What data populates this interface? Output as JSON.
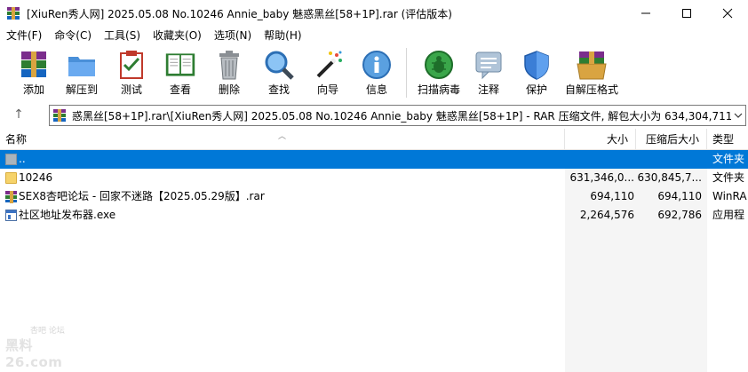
{
  "window": {
    "title": "[XiuRen秀人网] 2025.05.08 No.10246 Annie_baby 魅惑黑丝[58+1P].rar (评估版本)",
    "controls": [
      "minimize-icon",
      "maximize-icon",
      "close-icon"
    ]
  },
  "menu": [
    {
      "label": "文件(F)"
    },
    {
      "label": "命令(C)"
    },
    {
      "label": "工具(S)"
    },
    {
      "label": "收藏夹(O)"
    },
    {
      "label": "选项(N)"
    },
    {
      "label": "帮助(H)"
    }
  ],
  "toolbar": [
    {
      "label": "添加",
      "icon": "add-archive-icon"
    },
    {
      "label": "解压到",
      "icon": "extract-to-icon"
    },
    {
      "label": "测试",
      "icon": "test-icon"
    },
    {
      "label": "查看",
      "icon": "view-book-icon"
    },
    {
      "label": "删除",
      "icon": "trash-icon"
    },
    {
      "label": "查找",
      "icon": "magnifier-icon"
    },
    {
      "label": "向导",
      "icon": "wizard-wand-icon"
    },
    {
      "label": "信息",
      "icon": "info-icon"
    },
    {
      "label": "扫描病毒",
      "icon": "virus-scan-icon"
    },
    {
      "label": "注释",
      "icon": "comment-icon"
    },
    {
      "label": "保护",
      "icon": "shield-icon"
    },
    {
      "label": "自解压格式",
      "icon": "sfx-box-icon"
    }
  ],
  "address": {
    "up_glyph": "↑",
    "path": "惑黑丝[58+1P].rar\\[XiuRen秀人网] 2025.05.08 No.10246 Annie_baby 魅惑黑丝[58+1P] - RAR 压缩文件, 解包大小为 634,304,711 字节"
  },
  "columns": {
    "name": "名称",
    "size": "大小",
    "packed": "压缩后大小",
    "type": "类型"
  },
  "rows": [
    {
      "name": "..",
      "size": "",
      "packed": "",
      "type": "文件夹",
      "icon": "up-folder-icon",
      "selected": true
    },
    {
      "name": "10246",
      "size": "631,346,0...",
      "packed": "630,845,7...",
      "type": "文件夹",
      "icon": "folder-icon",
      "selected": false
    },
    {
      "name": "SEX8杏吧论坛 - 回家不迷路【2025.05.29版】.rar",
      "size": "694,110",
      "packed": "694,110",
      "type": "WinRA",
      "icon": "rar-file-icon",
      "selected": false
    },
    {
      "name": "社区地址发布器.exe",
      "size": "2,264,576",
      "packed": "692,786",
      "type": "应用程",
      "icon": "exe-file-icon",
      "selected": false
    }
  ],
  "watermark": {
    "top": "杏吧 论坛",
    "main": "黑料26.com"
  }
}
